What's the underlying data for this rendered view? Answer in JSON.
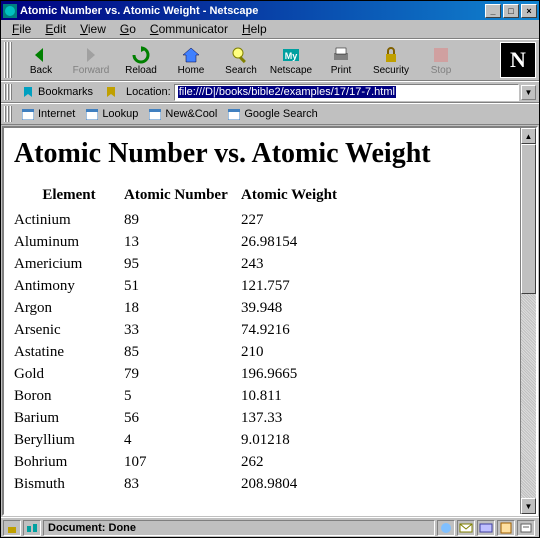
{
  "window": {
    "title": "Atomic Number vs. Atomic Weight - Netscape"
  },
  "menu": [
    "File",
    "Edit",
    "View",
    "Go",
    "Communicator",
    "Help"
  ],
  "toolbar": [
    {
      "id": "back",
      "label": "Back",
      "disabled": false
    },
    {
      "id": "forward",
      "label": "Forward",
      "disabled": true
    },
    {
      "id": "reload",
      "label": "Reload",
      "disabled": false
    },
    {
      "id": "home",
      "label": "Home",
      "disabled": false
    },
    {
      "id": "search",
      "label": "Search",
      "disabled": false
    },
    {
      "id": "netscape",
      "label": "Netscape",
      "disabled": false
    },
    {
      "id": "print",
      "label": "Print",
      "disabled": false
    },
    {
      "id": "security",
      "label": "Security",
      "disabled": false
    },
    {
      "id": "stop",
      "label": "Stop",
      "disabled": true
    }
  ],
  "location": {
    "bookmarks_label": "Bookmarks",
    "location_label": "Location:",
    "url": "file:///D|/books/bible2/examples/17/17-7.html"
  },
  "personal_toolbar": [
    "Internet",
    "Lookup",
    "New&Cool",
    "Google Search"
  ],
  "page": {
    "heading": "Atomic Number vs. Atomic Weight",
    "columns": [
      "Element",
      "Atomic Number",
      "Atomic Weight"
    ],
    "rows": [
      {
        "el": "Actinium",
        "num": "89",
        "wt": "227"
      },
      {
        "el": "Aluminum",
        "num": "13",
        "wt": "26.98154"
      },
      {
        "el": "Americium",
        "num": "95",
        "wt": "243"
      },
      {
        "el": "Antimony",
        "num": "51",
        "wt": "121.757"
      },
      {
        "el": "Argon",
        "num": "18",
        "wt": "39.948"
      },
      {
        "el": "Arsenic",
        "num": "33",
        "wt": "74.9216"
      },
      {
        "el": "Astatine",
        "num": "85",
        "wt": "210"
      },
      {
        "el": "Gold",
        "num": "79",
        "wt": "196.9665"
      },
      {
        "el": "Boron",
        "num": "5",
        "wt": "10.811"
      },
      {
        "el": "Barium",
        "num": "56",
        "wt": "137.33"
      },
      {
        "el": "Beryllium",
        "num": "4",
        "wt": "9.01218"
      },
      {
        "el": "Bohrium",
        "num": "107",
        "wt": "262"
      },
      {
        "el": "Bismuth",
        "num": "83",
        "wt": "208.9804"
      }
    ]
  },
  "status": {
    "text": "Document: Done"
  }
}
